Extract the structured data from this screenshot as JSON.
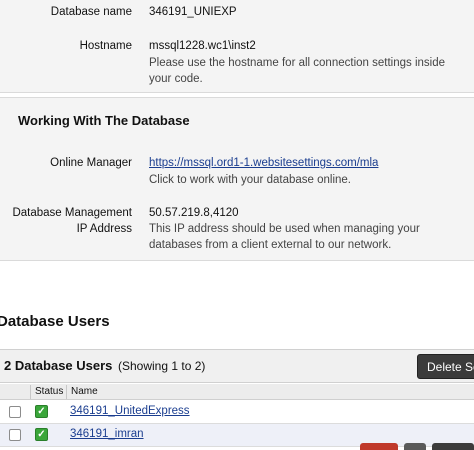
{
  "database": {
    "name_label": "Database name",
    "name_value": "346191_UNIEXP",
    "hostname_label": "Hostname",
    "hostname_value": "mssql1228.wc1\\inst2",
    "hostname_help_line1": "Please use the hostname for all connection settings inside",
    "hostname_help_line2": "your code."
  },
  "working": {
    "title": "Working With The Database",
    "online_manager_label": "Online Manager",
    "online_manager_link": "https://mssql.ord1-1.websitesettings.com/mla",
    "online_manager_help": "Click to work with your database online.",
    "mgmt_label_line1": "Database Management",
    "mgmt_label_line2": "IP Address",
    "mgmt_ip": "50.57.219.8,4120",
    "mgmt_help_line1": "This IP address should be used when managing your",
    "mgmt_help_line2": "databases from a client external to our network."
  },
  "users": {
    "heading": "Database Users",
    "count_label": "2 Database Users",
    "showing": "(Showing 1 to 2)",
    "delete_button": "Delete Se",
    "columns": [
      "Status",
      "Name"
    ],
    "rows": [
      {
        "name": "346191_UnitedExpress",
        "status": "active"
      },
      {
        "name": "346191_imran",
        "status": "active"
      }
    ]
  },
  "icons": {
    "status_active": "checkmark-icon",
    "status_color": "#3aa63a"
  }
}
